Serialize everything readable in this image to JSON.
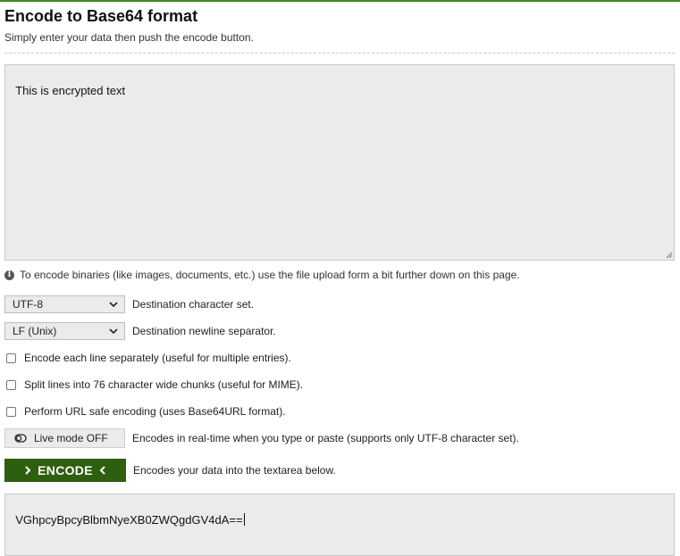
{
  "header": {
    "title": "Encode to Base64 format",
    "subtitle": "Simply enter your data then push the encode button."
  },
  "input": {
    "value": "This is encrypted text"
  },
  "info": {
    "text": "To encode binaries (like images, documents, etc.) use the file upload form a bit further down on this page."
  },
  "options": {
    "charset": {
      "selected": "UTF-8",
      "label": "Destination character set."
    },
    "newline": {
      "selected": "LF (Unix)",
      "label": "Destination newline separator."
    },
    "each_line": {
      "label": "Encode each line separately (useful for multiple entries).",
      "checked": false
    },
    "split_lines": {
      "label": "Split lines into 76 character wide chunks (useful for MIME).",
      "checked": false
    },
    "url_safe": {
      "label": "Perform URL safe encoding (uses Base64URL format).",
      "checked": false
    },
    "live_mode": {
      "button": "Live mode OFF",
      "label": "Encodes in real-time when you type or paste (supports only UTF-8 character set)."
    }
  },
  "encode": {
    "button": "ENCODE",
    "label": "Encodes your data into the textarea below."
  },
  "output": {
    "value": "VGhpcyBpcyBlbmNyeXB0ZWQgdGV4dA=="
  },
  "colors": {
    "accent": "#3a8a1f",
    "button": "#2d5f0e",
    "field": "#ebebeb"
  }
}
